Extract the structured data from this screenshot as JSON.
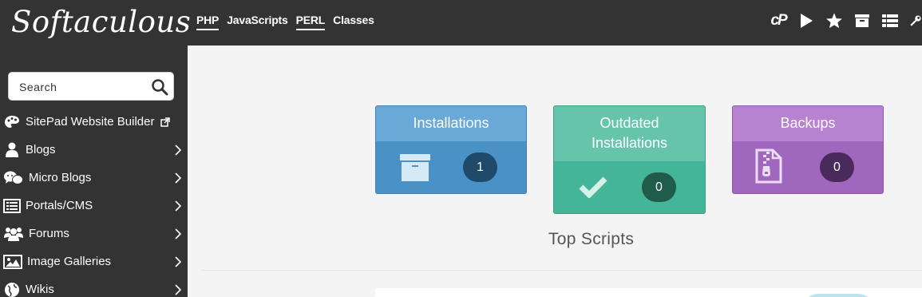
{
  "brand": {
    "logo_text": "Softaculous"
  },
  "topnav": [
    {
      "label": "PHP",
      "underlined": true
    },
    {
      "label": "JavaScripts",
      "underlined": false
    },
    {
      "label": "PERL",
      "underlined": true
    },
    {
      "label": "Classes",
      "underlined": false
    }
  ],
  "top_icons": {
    "cpanel_text": "cP",
    "items": [
      "cpanel-icon",
      "play-icon",
      "star-icon",
      "archive-icon",
      "list-icon",
      "wrench-icon"
    ]
  },
  "search": {
    "placeholder": "Search",
    "value": ""
  },
  "sidebar": {
    "items": [
      {
        "label": "SitePad Website Builder",
        "icon": "palette-icon",
        "external": true
      },
      {
        "label": "Blogs",
        "icon": "user-icon",
        "chevron": true
      },
      {
        "label": "Micro Blogs",
        "icon": "chat-bubbles-icon",
        "chevron": true
      },
      {
        "label": "Portals/CMS",
        "icon": "list-box-icon",
        "chevron": true
      },
      {
        "label": "Forums",
        "icon": "users-icon",
        "chevron": true
      },
      {
        "label": "Image Galleries",
        "icon": "image-icon",
        "chevron": true
      },
      {
        "label": "Wikis",
        "icon": "globe-icon",
        "chevron": true
      }
    ]
  },
  "cards": {
    "installations": {
      "title": "Installations",
      "count": "1",
      "icon": "archive-icon"
    },
    "outdated": {
      "title_line1": "Outdated",
      "title_line2": "Installations",
      "count": "0",
      "icon": "check-icon"
    },
    "backups": {
      "title": "Backups",
      "count": "0",
      "icon": "zip-file-icon"
    }
  },
  "colors": {
    "topbar": "#333333",
    "installations": "#4a92c6",
    "outdated": "#45b599",
    "backups": "#a067bf"
  },
  "main": {
    "section_title": "Top Scripts"
  }
}
